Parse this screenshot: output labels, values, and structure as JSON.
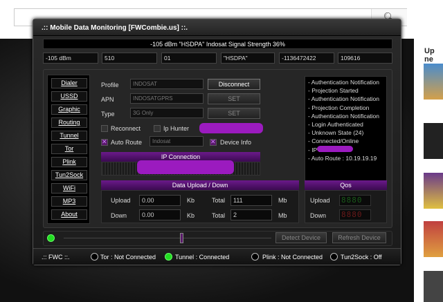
{
  "window": {
    "title": ".:: Mobile Data Monitoring [FWCombie.us] ::.",
    "signal_text": "-105 dBm \"HSDPA\" Indosat Signal Strength 36%"
  },
  "info_boxes": [
    "-105 dBm",
    "510",
    "01",
    "\"HSDPA\"",
    "-1136472422",
    "109616"
  ],
  "nav": [
    "Dialer",
    "USSD",
    "Graphic",
    "Routing",
    "Tunnel",
    "Tor",
    "Plink",
    "Tun2Sock",
    "WiFi",
    "MP3",
    "About"
  ],
  "form": {
    "profile_label": "Profile",
    "profile_value": "INDOSAT",
    "apn_label": "APN",
    "apn_value": "INDOSATGPRS",
    "type_label": "Type",
    "type_value": "3G Only",
    "disconnect_label": "Disconnect",
    "set_label_1": "SET",
    "set_label_2": "SET",
    "reconnect_label": "Reconnect",
    "iphunter_label": "Ip Hunter",
    "autoroute_label": "Auto Route",
    "autoroute_value": "Indosat",
    "deviceinfo_label": "Device Info",
    "ip_connection_label": "IP Connection"
  },
  "log": [
    "- Authentication Notification",
    "- Projection Started",
    "- Authentication Notification",
    "- Projection Completion",
    "- Authentication Notification",
    "- Login Authenticated",
    "- Unknown State (24)",
    "- Connected/Online",
    "- IP :",
    "- Auto Route : 10.19.19.19"
  ],
  "data_panel": {
    "title": "Data Upload / Down",
    "upload_label": "Upload",
    "upload_value": "0.00",
    "upload_unit": "Kb",
    "upload_total_label": "Total",
    "upload_total": "111",
    "upload_total_unit": "Mb",
    "down_label": "Down",
    "down_value": "0.00",
    "down_unit": "Kb",
    "down_total_label": "Total",
    "down_total": "2",
    "down_total_unit": "Mb"
  },
  "qos": {
    "title": "Qos",
    "upload_label": "Upload",
    "upload_digits": "8880",
    "down_label": "Down",
    "down_digits": "8880"
  },
  "controls": {
    "detect_label": "Detect Device",
    "refresh_label": "Refresh Device"
  },
  "status": {
    "fwc_label": ".:: FWC ::.",
    "tor": "Tor : Not Connected",
    "tunnel": "Tunnel : Connected",
    "plink": "Plink : Not Connected",
    "tun2sock": "Tun2Sock : Off"
  },
  "background": {
    "upnext": "Up ne"
  },
  "colors": {
    "accent": "#6b1a8a",
    "redaction": "#9b1bbf",
    "online_green": "#22dd22",
    "qos_down_red": "#dd2222"
  }
}
